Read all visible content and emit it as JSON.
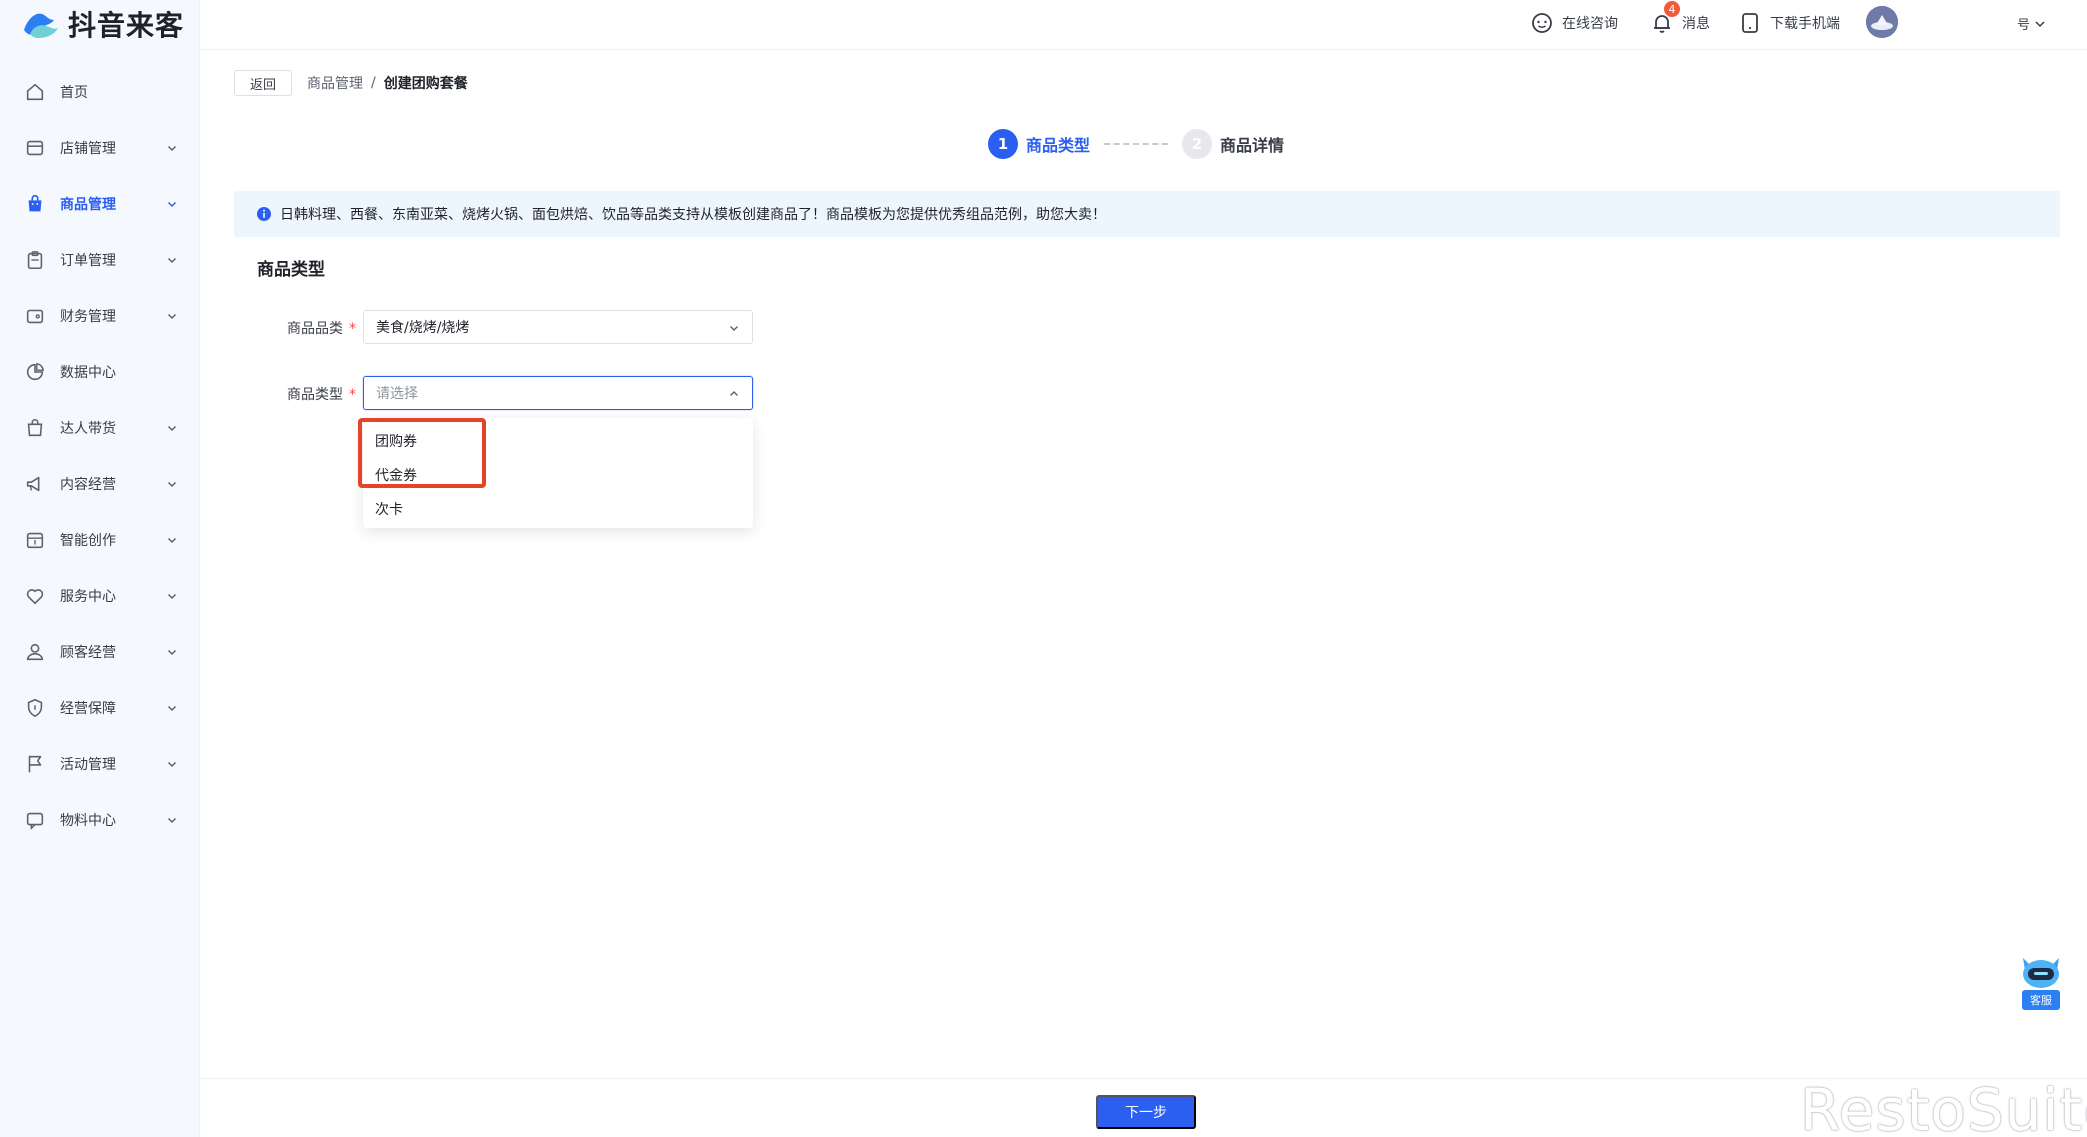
{
  "brand": {
    "name": "抖音来客"
  },
  "sidebar": {
    "items": [
      {
        "label": "首页",
        "icon": "home-icon",
        "has_children": false
      },
      {
        "label": "店铺管理",
        "icon": "store-icon",
        "has_children": true
      },
      {
        "label": "商品管理",
        "icon": "bag-icon",
        "has_children": true,
        "active": true
      },
      {
        "label": "订单管理",
        "icon": "clipboard-icon",
        "has_children": true
      },
      {
        "label": "财务管理",
        "icon": "wallet-icon",
        "has_children": true
      },
      {
        "label": "数据中心",
        "icon": "pie-chart-icon",
        "has_children": false
      },
      {
        "label": "达人带货",
        "icon": "shopping-bag-icon",
        "has_children": true
      },
      {
        "label": "内容经营",
        "icon": "megaphone-icon",
        "has_children": true
      },
      {
        "label": "智能创作",
        "icon": "calendar-icon",
        "has_children": true
      },
      {
        "label": "服务中心",
        "icon": "heart-icon",
        "has_children": true
      },
      {
        "label": "顾客经营",
        "icon": "user-icon",
        "has_children": true
      },
      {
        "label": "经营保障",
        "icon": "shield-icon",
        "has_children": true
      },
      {
        "label": "活动管理",
        "icon": "flag-icon",
        "has_children": true
      },
      {
        "label": "物料中心",
        "icon": "message-box-icon",
        "has_children": true
      }
    ]
  },
  "header": {
    "consult_label": "在线咨询",
    "message_label": "消息",
    "message_badge": "4",
    "download_label": "下载手机端",
    "user_menu_label": "号"
  },
  "page": {
    "back_label": "返回",
    "breadcrumb": {
      "parent": "商品管理",
      "separator": "/",
      "current": "创建团购套餐"
    },
    "steps": [
      {
        "number": "1",
        "label": "商品类型",
        "state": "active"
      },
      {
        "number": "2",
        "label": "商品详情",
        "state": "inactive"
      }
    ],
    "notice": "日韩料理、西餐、东南亚菜、烧烤火锅、面包烘焙、饮品等品类支持从模板创建商品了！商品模板为您提供优秀组品范例，助您大卖！",
    "section_title": "商品类型",
    "form": {
      "category": {
        "label": "商品品类",
        "required_mark": "*",
        "value": "美食/烧烤/烧烤"
      },
      "type": {
        "label": "商品类型",
        "required_mark": "*",
        "placeholder": "请选择",
        "value": ""
      }
    },
    "type_options": [
      "团购券",
      "代金券",
      "次卡"
    ],
    "next_label": "下一步"
  },
  "customer_service": {
    "label": "客服"
  },
  "watermark": "RestoSuite",
  "colors": {
    "primary": "#2b5ff2",
    "highlight": "#e24527",
    "notice_bg": "#eef6fd"
  }
}
